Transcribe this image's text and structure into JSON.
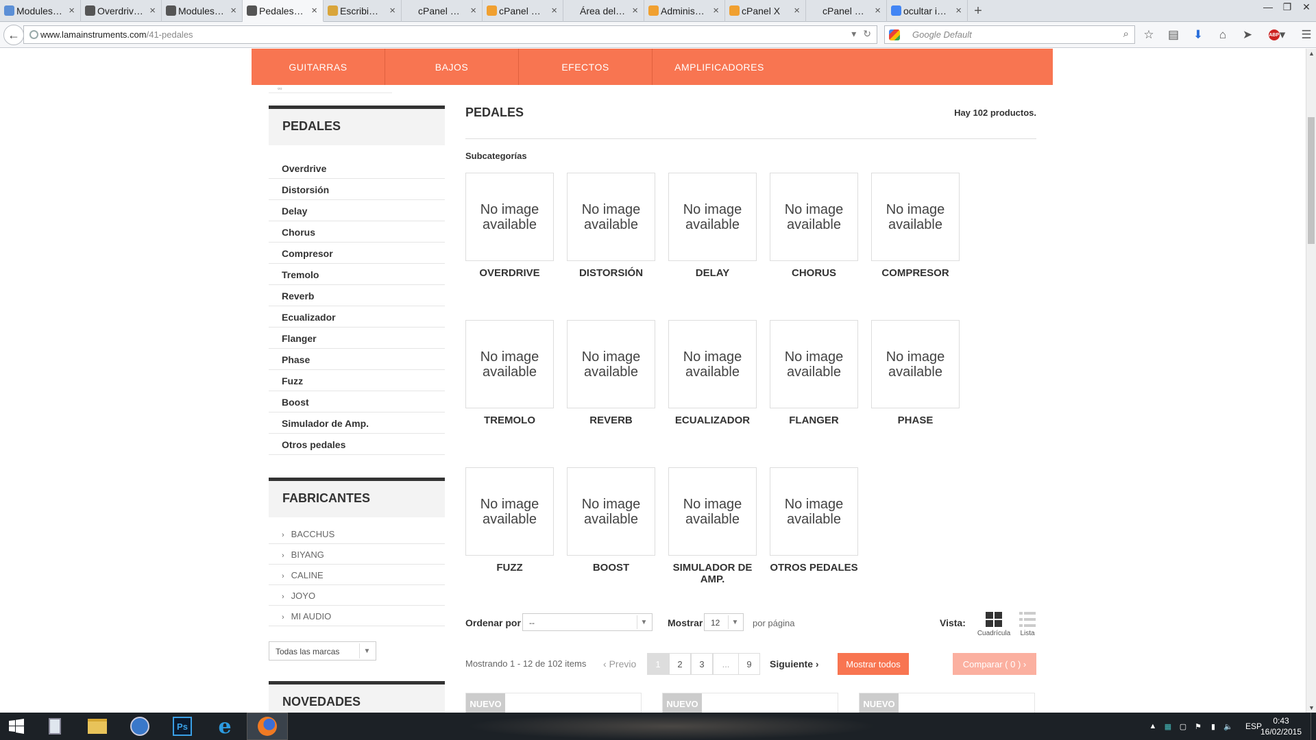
{
  "browser": {
    "tabs": [
      {
        "label": "Modules • La...",
        "favicon": "blue-square",
        "color": "#5b8fd6"
      },
      {
        "label": "Overdrive - La...",
        "favicon": "prestashop",
        "color": "#555555"
      },
      {
        "label": "Modules • La...",
        "favicon": "prestashop",
        "color": "#555555"
      },
      {
        "label": "Pedales - Lam...",
        "favicon": "prestashop",
        "color": "#555555"
      },
      {
        "label": "Escribiendo n...",
        "favicon": "forum",
        "color": "#d9a53a"
      },
      {
        "label": "cPanel X - File Ma...",
        "favicon": "none",
        "color": "#dfe3e8"
      },
      {
        "label": "cPanel X - Ad...",
        "favicon": "cpanel",
        "color": "#f0a030"
      },
      {
        "label": "Área del Cliente - ...",
        "favicon": "none",
        "color": "#dfe3e8"
      },
      {
        "label": "Administrador...",
        "favicon": "cpanel",
        "color": "#f0a030"
      },
      {
        "label": "cPanel X",
        "favicon": "cpanel",
        "color": "#f0a030"
      },
      {
        "label": "cPanel File Manag...",
        "favicon": "none",
        "color": "#dfe3e8"
      },
      {
        "label": "ocultar image...",
        "favicon": "google",
        "color": "#4285f4"
      }
    ],
    "active_tab": 3,
    "url_domain": "www.lamainstruments.com",
    "url_path": "/41-pedales",
    "search_placeholder": "Google Default",
    "abp_count": "ABP"
  },
  "top_menu": [
    "GUITARRAS",
    "BAJOS",
    "EFECTOS",
    "AMPLIFICADORES"
  ],
  "sidebar": {
    "categories_title": "PEDALES",
    "categories": [
      "Overdrive",
      "Distorsión",
      "Delay",
      "Chorus",
      "Compresor",
      "Tremolo",
      "Reverb",
      "Ecualizador",
      "Flanger",
      "Phase",
      "Fuzz",
      "Boost",
      "Simulador de Amp.",
      "Otros pedales"
    ],
    "brands_title": "FABRICANTES",
    "brands": [
      "BACCHUS",
      "BIYANG",
      "CALINE",
      "JOYO",
      "MI AUDIO"
    ],
    "brands_select": "Todas las marcas",
    "news_title": "NOVEDADES"
  },
  "main": {
    "title": "PEDALES",
    "count": "Hay 102 productos.",
    "subcategories_title": "Subcategorías",
    "no_image_line1": "No image",
    "no_image_line2": "available",
    "subcategories": [
      "OVERDRIVE",
      "DISTORSIÓN",
      "DELAY",
      "CHORUS",
      "COMPRESOR",
      "TREMOLO",
      "REVERB",
      "ECUALIZADOR",
      "FLANGER",
      "PHASE",
      "FUZZ",
      "BOOST",
      "SIMULADOR DE AMP.",
      "OTROS PEDALES"
    ],
    "sort_label": "Ordenar por",
    "sort_value": "--",
    "show_label": "Mostrar",
    "show_value": "12",
    "per_page": "por página",
    "view_label": "Vista:",
    "view_grid": "Cuadrícula",
    "view_list": "Lista",
    "showing": "Mostrando 1 - 12 de 102 items",
    "prev": "Previo",
    "pages": [
      "1",
      "2",
      "3",
      "...",
      "9"
    ],
    "current_page": "1",
    "next": "Siguiente",
    "show_all": "Mostrar todos",
    "compare": "Comparar ( 0 )",
    "product_badge": "NUEVO"
  },
  "taskbar": {
    "lang": "ESP",
    "time": "0:43",
    "date": "16/02/2015"
  },
  "colors": {
    "accent": "#f87551",
    "compare": "#fbb0a0"
  }
}
